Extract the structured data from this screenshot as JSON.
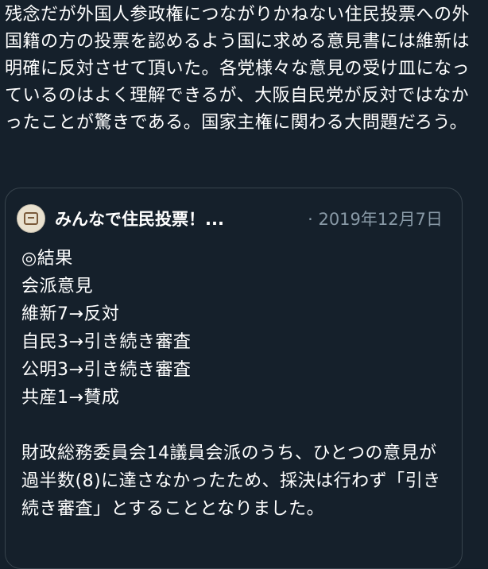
{
  "tweet": {
    "text": "残念だが外国人参政権につながりかねない住民投票への外国籍の方の投票を認めるよう国に求める意見書には維新は明確に反対させて頂いた。各党様々な意見の受け皿になっているのはよく理解できるが、大阪自民党が反対ではなかったことが驚きである。国家主権に関わる大問題だろう。"
  },
  "quote": {
    "author_name": "みんなで住民投票！...",
    "date": "· 2019年12月7日",
    "body": "◎結果\n会派意見\n維新7→反対\n自民3→引き続き審査\n公明3→引き続き審査\n共産1→賛成\n\n財政総務委員会14議員会派のうち、ひとつの意見が過半数(8)に達さなかったため、採決は行わず「引き続き審査」とすることとなりました。"
  },
  "colors": {
    "background": "#15202b",
    "text": "#ffffff",
    "muted": "#8899a6",
    "border": "#38444d"
  }
}
